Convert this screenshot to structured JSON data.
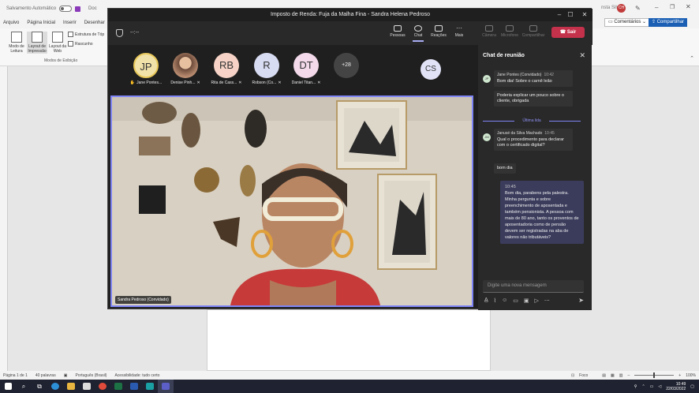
{
  "word": {
    "autosave_label": "Salvamento Automático",
    "doc_title_partial": "Doc",
    "user_name_partial": "nsta Silva",
    "user_initials": "CH",
    "menu": [
      "Arquivo",
      "Página Inicial",
      "Inserir",
      "Desenhar"
    ],
    "comments_label": "Comentários",
    "share_label": "Compartilhar",
    "ribbon": {
      "read_mode": "Modo de Leitura",
      "print_layout": "Layout de Impressão",
      "web_layout": "Layout da Web",
      "outline": "Estrutura de Tóp",
      "draft": "Rascunho",
      "group_label": "Modos de Exibição"
    },
    "status": {
      "page": "Página 1 de 1",
      "words": "40 palavras",
      "language": "Português (Brasil)",
      "accessibility": "Acessibilidade: tudo certo",
      "focus": "Foco",
      "zoom": "100%"
    }
  },
  "taskbar": {
    "time": "10:49",
    "date": "22/03/2022",
    "icons": [
      "windows-icon",
      "search-icon",
      "task-view-icon",
      "edge-icon",
      "file-explorer-icon",
      "mail-icon",
      "chrome-icon",
      "excel-icon",
      "word-icon",
      "whiteboard-icon",
      "teams-icon"
    ]
  },
  "teams": {
    "window_title": "Imposto de Renda: Fuja da Malha Fina - Sandra Helena Pedroso",
    "timer": "--:--",
    "tools": {
      "people": "Pessoas",
      "chat": "Chat",
      "reactions": "Reações",
      "more": "Mais",
      "camera": "Câmera",
      "mic": "Microfone",
      "share": "Compartilhar"
    },
    "leave_label": "Sair",
    "participants": [
      {
        "initials": "JP",
        "name": "Jane Pontes...",
        "color": "#f1e2a9"
      },
      {
        "initials": "",
        "name": "Denise Pinh...",
        "color": "#c9a48c"
      },
      {
        "initials": "RB",
        "name": "Rita de Cass...",
        "color": "#f6d3c6"
      },
      {
        "initials": "R",
        "name": "Robson (Co...",
        "color": "#d8dcf3"
      },
      {
        "initials": "DT",
        "name": "Daniel Titan...",
        "color": "#f3d9ea"
      }
    ],
    "more_count": "+28",
    "self_initials": "CS",
    "video_name": "Sandra Pedroso (Convidado)",
    "chat": {
      "title": "Chat de reunião",
      "divider": "Última lida",
      "messages": [
        {
          "author": "Jane Pontes (Convidado)",
          "time": "10:42",
          "initials": "JP",
          "text": "Bom dia! Sobre o carnê leão"
        },
        {
          "text": "Poderia explicar um pouco sobre o cliente, obrigada"
        },
        {
          "author": "Janusé da Silva Machado",
          "time": "10:45",
          "initials": "JM",
          "text": "Qual o procedimento para declarar com o certificado digital?"
        },
        {
          "text": "bom dia"
        },
        {
          "time": "10:45",
          "text": "Bom dia, parabens pela palestra. Minha pergunta e sobre preenchimento de aposentada e também pensionista. A pessoa com mais de 80 ano, tanto os proventos de aposentadoria como de pensão devem ser registradas na aba de valores não tributáveis?"
        }
      ],
      "compose_placeholder": "Digite uma nova mensagem"
    }
  }
}
